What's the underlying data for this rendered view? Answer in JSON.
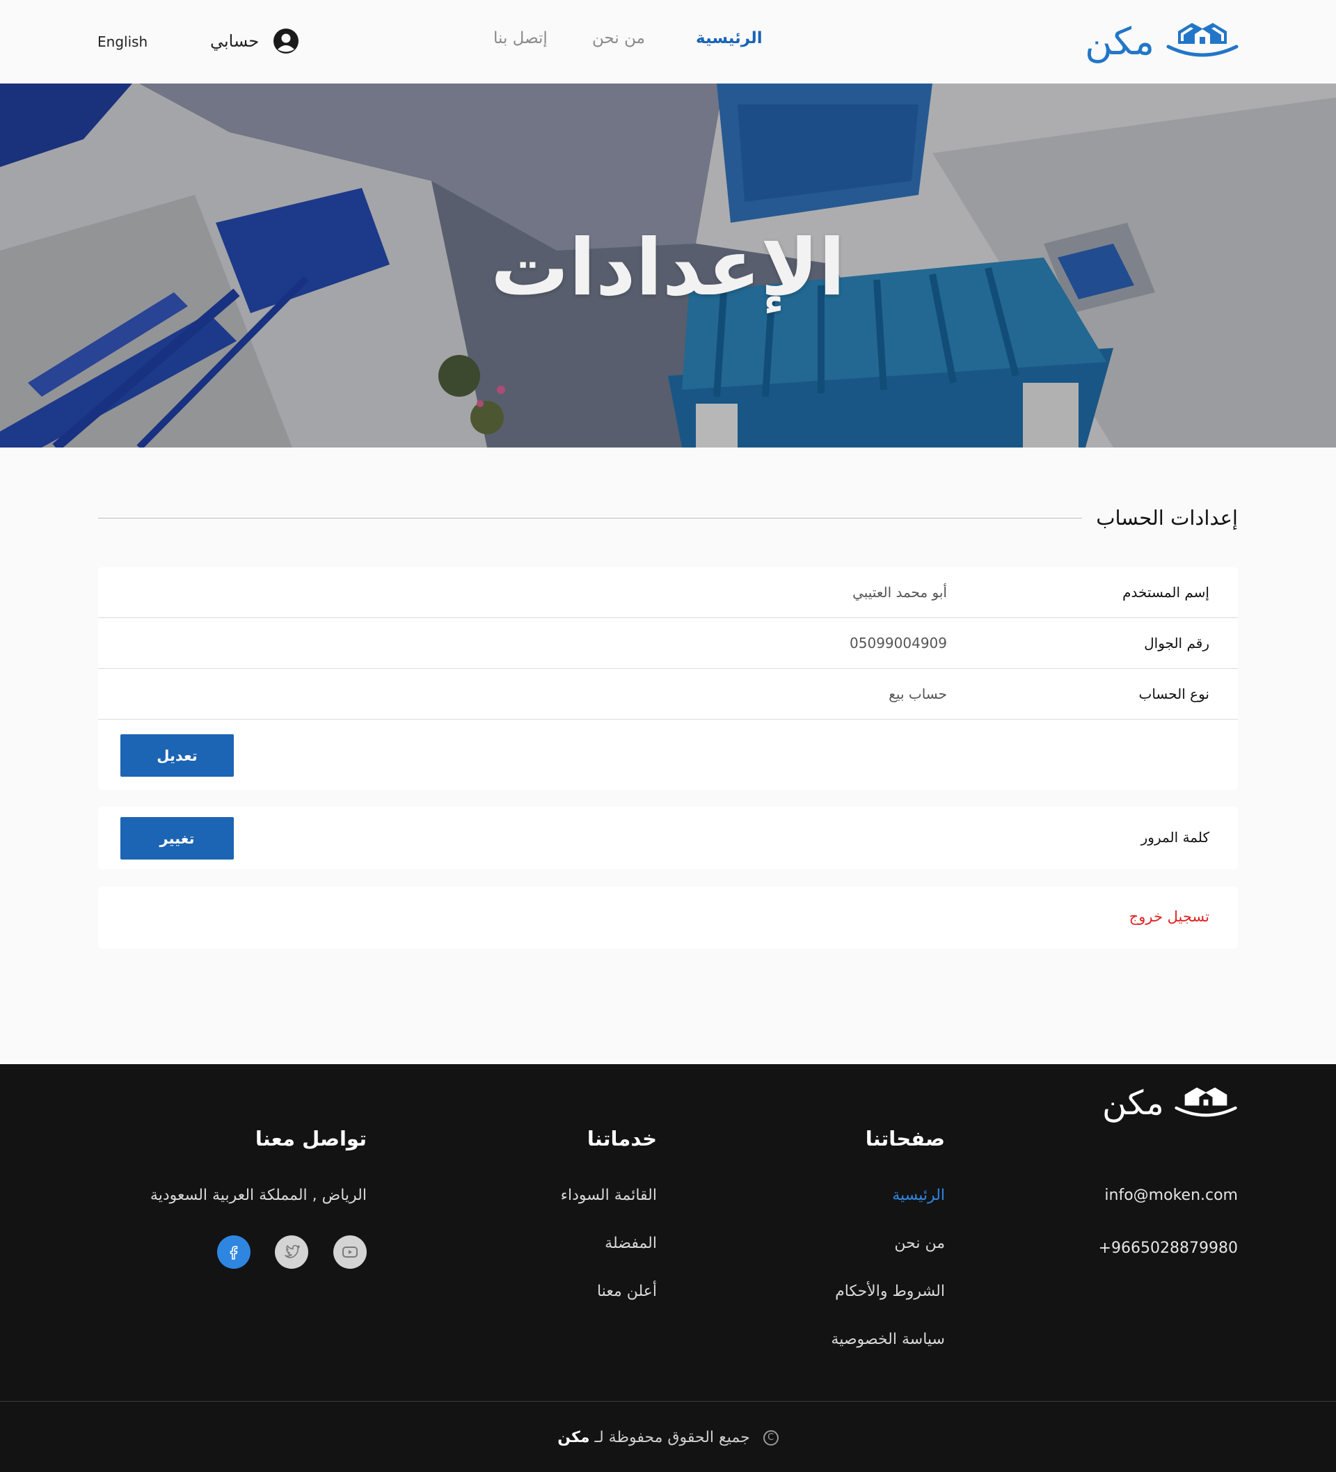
{
  "header": {
    "logo_text": "مكن",
    "nav": [
      {
        "label": "الرئيسية",
        "active": true
      },
      {
        "label": "من نحن",
        "active": false
      },
      {
        "label": "إتصل بنا",
        "active": false
      }
    ],
    "account_label": "حسابي",
    "language_label": "English"
  },
  "hero": {
    "title": "الإعدادات"
  },
  "account_settings": {
    "heading": "إعدادات الحساب",
    "rows": [
      {
        "label": "إسم المستخدم",
        "value": "أبو محمد العتيبي"
      },
      {
        "label": "رقم الجوال",
        "value": "05099004909"
      },
      {
        "label": "نوع الحساب",
        "value": "حساب بيع"
      }
    ],
    "edit_button": "تعديل",
    "password_label": "كلمة المرور",
    "change_button": "تغيير",
    "logout_label": "تسجيل خروج"
  },
  "footer": {
    "logo_text": "مكن",
    "email": "info@moken.com",
    "phone": "+9665028879980",
    "pages_title": "صفحاتنا",
    "pages": [
      "الرئيسية",
      "من نحن",
      "الشروط والأحكام",
      "سياسة الخصوصية"
    ],
    "services_title": "خدماتنا",
    "services": [
      "القائمة السوداء",
      "المفضلة",
      "أعلن معنا"
    ],
    "contact_title": "تواصل معنا",
    "address": "الرياض , المملكة العربية السعودية",
    "social_icons": [
      "youtube-icon",
      "twitter-icon",
      "facebook-icon"
    ],
    "copyright_text": "جميع الحقوق محفوظة لـ",
    "copyright_brand": "مكن"
  },
  "colors": {
    "brand_blue": "#2276c7",
    "button_blue": "#1c64b4",
    "logout_red": "#e02424",
    "footer_bg": "#131313"
  }
}
